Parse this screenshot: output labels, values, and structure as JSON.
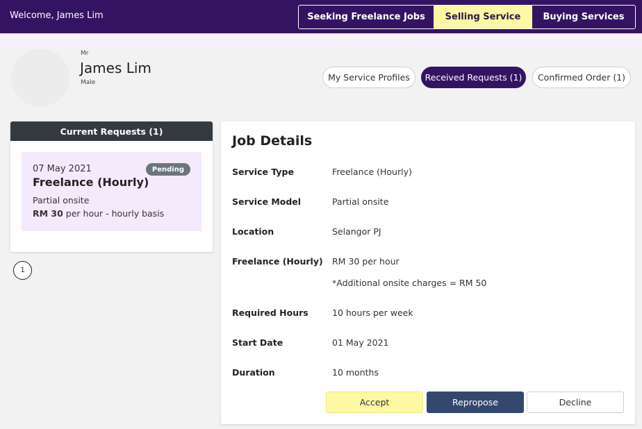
{
  "topbar": {
    "welcome": "Welcome, James Lim",
    "modes": [
      "Seeking Freelance Jobs",
      "Selling Service",
      "Buying Services"
    ],
    "active_mode": "Selling Service",
    "bg_color": "#341462",
    "active_color": "#fdf8a4"
  },
  "profile": {
    "salutation": "Mr",
    "name": "James Lim",
    "gender": "Male",
    "tabs": [
      "My Service Profiles",
      "Received Requests (1)",
      "Confirmed Order (1)"
    ],
    "active_tab": "Received Requests (1)"
  },
  "requests": {
    "header": "Current Requests (1)",
    "item": {
      "date": "07 May 2021",
      "status": "Pending",
      "title": "Freelance (Hourly)",
      "model": "Partial onsite",
      "rate_amount": "RM 30",
      "rate_suffix": " per hour - hourly basis"
    },
    "page": "1"
  },
  "details": {
    "title": "Job Details",
    "rows": [
      {
        "label": "Service Type",
        "value": "Freelance (Hourly)"
      },
      {
        "label": "Service Model",
        "value": "Partial onsite"
      },
      {
        "label": "Location",
        "value": "Selangor PJ"
      },
      {
        "label": "Freelance (Hourly)",
        "value": "RM 30 per hour",
        "note": "*Additional onsite charges = RM 50"
      },
      {
        "label": "Required Hours",
        "value": "10 hours per week"
      },
      {
        "label": "Start Date",
        "value": "01 May 2021"
      },
      {
        "label": "Duration",
        "value": "10 months"
      }
    ],
    "actions": {
      "accept": "Accept",
      "repropose": "Repropose",
      "decline": "Decline"
    }
  }
}
